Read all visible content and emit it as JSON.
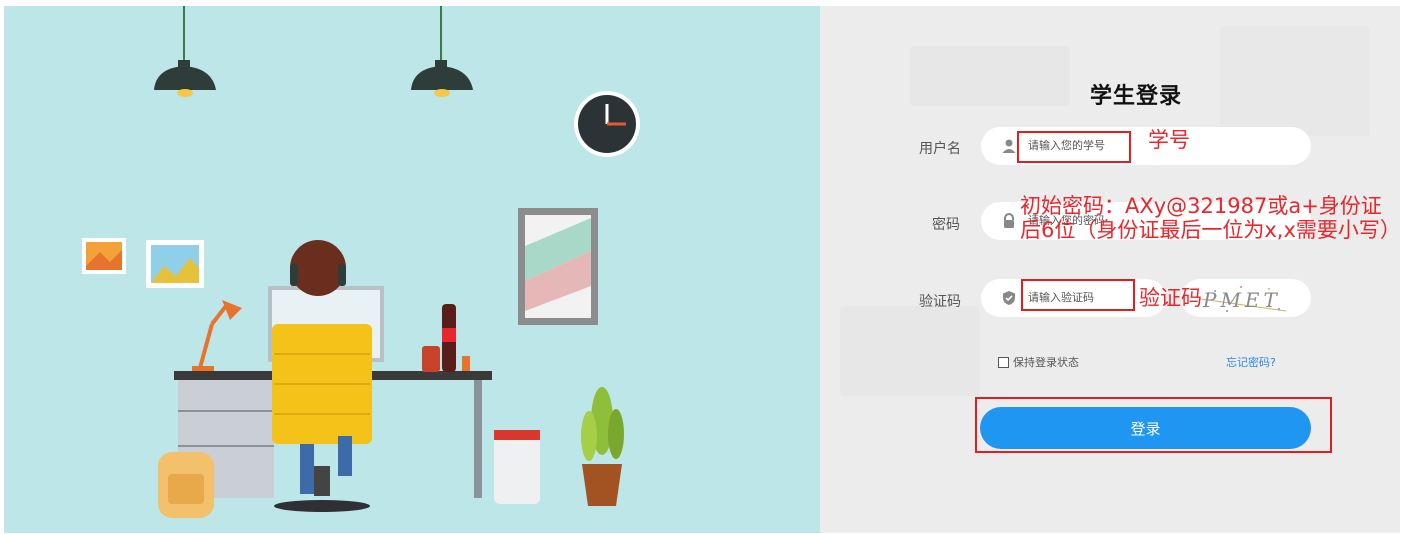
{
  "login": {
    "title": "学生登录",
    "username_label": "用户名",
    "username_placeholder": "请输入您的学号",
    "password_label": "密码",
    "password_placeholder": "请输入您的密码",
    "captcha_label": "验证码",
    "captcha_placeholder": "请输入验证码",
    "captcha_text": "PMET",
    "remember_label": "保持登录状态",
    "forgot_label": "忘记密码?",
    "submit_label": "登录"
  },
  "annotations": {
    "username_note": "学号",
    "password_note_line1": "初始密码：AXy@321987或a+身份证",
    "password_note_line2": "后6位（身份证最后一位为x,x需要小写）",
    "captcha_note": "验证码"
  },
  "colors": {
    "illustration_bg": "#bde6e8",
    "accent_red": "#e02020",
    "button_blue": "#1e96f2"
  }
}
